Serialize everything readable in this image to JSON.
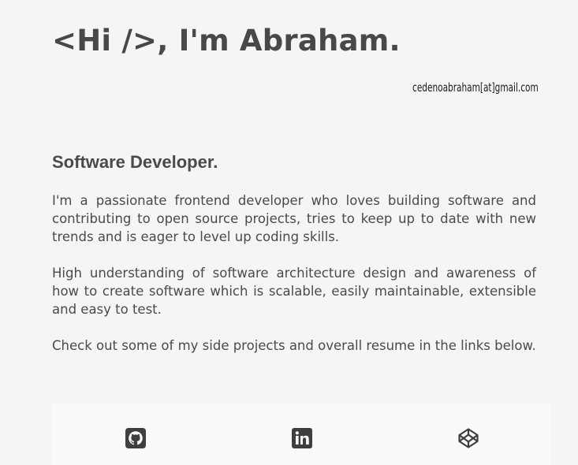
{
  "header": {
    "greeting": "<Hi />, I'm Abraham.",
    "email": "cedenoabraham[at]gmail.com"
  },
  "about": {
    "role": "Software Developer.",
    "paragraphs": [
      "I'm a passionate frontend developer who loves building software and contributing to open source projects, tries to keep up to date with new trends and is eager to level up coding skills.",
      "High understanding of software architecture design and awareness of how to create software which is scalable, easily maintainable, extensible and easy to test.",
      "Check out some of my side projects and overall resume in the links below."
    ]
  },
  "links": [
    {
      "icon": "github-icon"
    },
    {
      "icon": "linkedin-icon"
    },
    {
      "icon": "codepen-icon"
    }
  ],
  "colors": {
    "background": "#f6f5f5",
    "text": "#484848",
    "icon": "#3f3f3f"
  }
}
